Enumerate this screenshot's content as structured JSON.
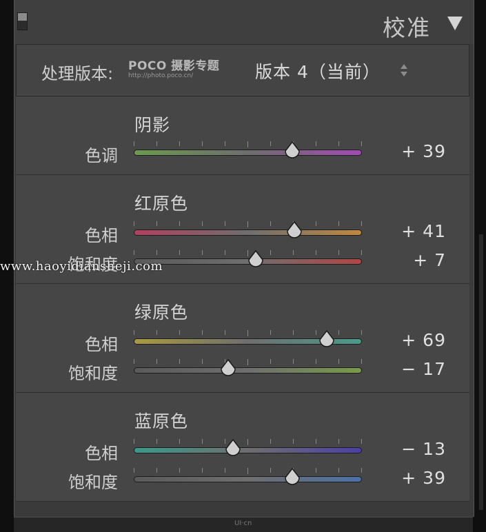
{
  "panel": {
    "title": "校准",
    "toggle_icon": "panel-switch-icon",
    "collapse_icon": "triangle-down-icon"
  },
  "process": {
    "label": "处理版本:",
    "value": "版本 4（当前）",
    "watermark_line1": "POCO 摄影专题",
    "watermark_line2": "http://photo.poco.cn/"
  },
  "sections": [
    {
      "title": "阴影",
      "sliders": [
        {
          "label": "色调",
          "value": "+ 39",
          "amount": 39,
          "gradient": [
            "#6a9a4e",
            "#a04ab0"
          ]
        }
      ]
    },
    {
      "title": "红原色",
      "sliders": [
        {
          "label": "色相",
          "value": "+ 41",
          "amount": 41,
          "gradient": [
            "#b2405e",
            "#c08840"
          ]
        },
        {
          "label": "饱和度",
          "value": "+ 7",
          "amount": 7,
          "gradient": [
            "#5a5a5a",
            "#b04646"
          ]
        }
      ]
    },
    {
      "title": "绿原色",
      "sliders": [
        {
          "label": "色相",
          "value": "+ 69",
          "amount": 69,
          "gradient": [
            "#a89a40",
            "#4a9a8a"
          ]
        },
        {
          "label": "饱和度",
          "value": "− 17",
          "amount": -17,
          "gradient": [
            "#5a5a5a",
            "#7a9a4a"
          ]
        }
      ]
    },
    {
      "title": "蓝原色",
      "sliders": [
        {
          "label": "色相",
          "value": "− 13",
          "amount": -13,
          "gradient": [
            "#3a9a8a",
            "#4a40a6"
          ]
        },
        {
          "label": "饱和度",
          "value": "+ 39",
          "amount": 39,
          "gradient": [
            "#5a5a5a",
            "#4a70a6"
          ]
        }
      ]
    }
  ],
  "site_watermark": "www.haoyidianshejі.com",
  "footer_logo": "UI·cn"
}
